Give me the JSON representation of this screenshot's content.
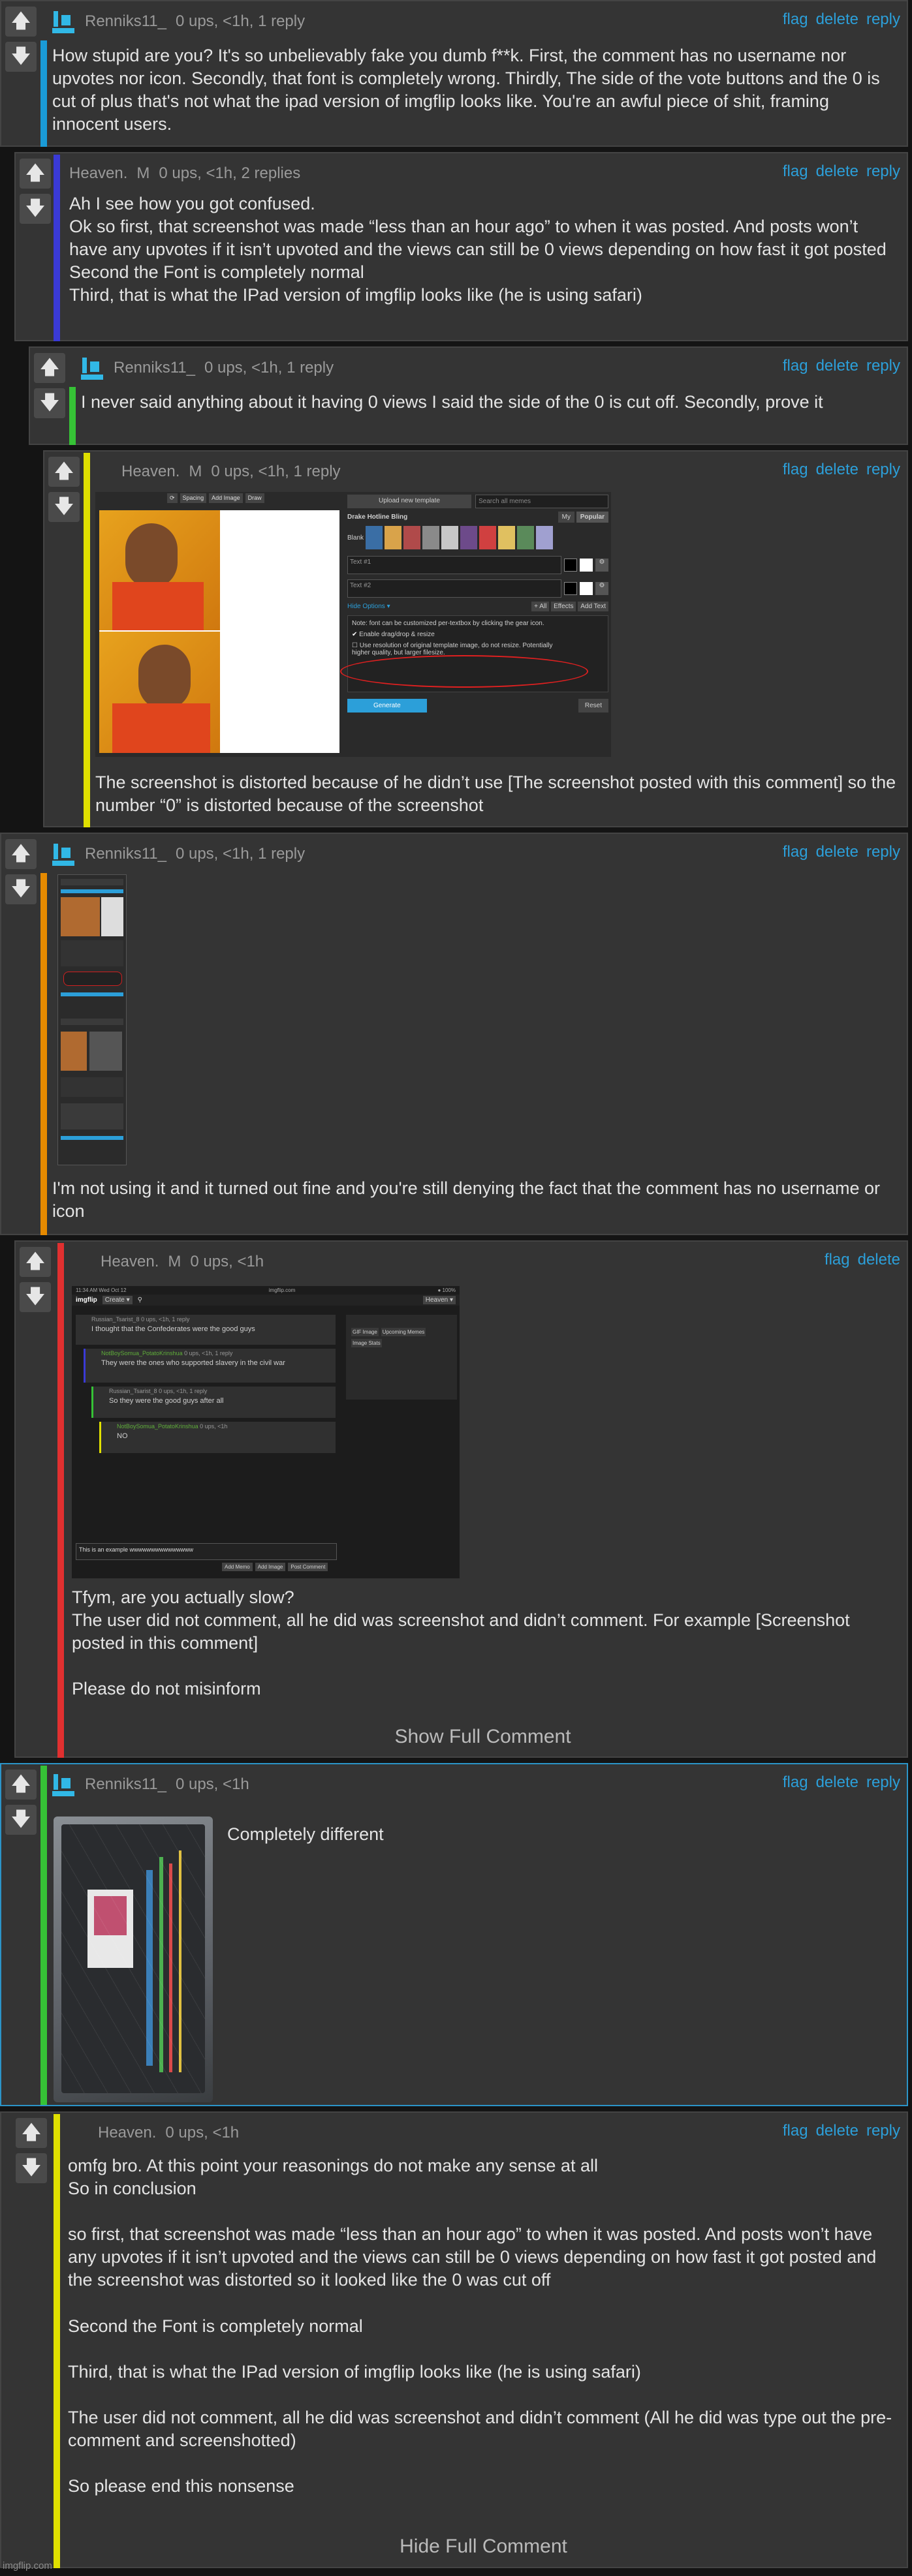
{
  "comments": [
    {
      "user": "Renniks11_",
      "meta": "0 ups, <1h, 1 reply",
      "actions": [
        "flag",
        "delete",
        "reply"
      ],
      "bar_color": "#1a9ad6",
      "text": "How stupid are you? It's so unbelievably fake you dumb f**k. First, the comment has no username nor upvotes nor icon. Secondly, that font is completely wrong. Thirdly, The side of the vote buttons and the 0 is cut of plus that's not what the ipad version of imgflip looks like. You're an awful piece of shit, framing innocent users."
    },
    {
      "user": "Heaven.",
      "user_tag": "M",
      "meta": "0 ups, <1h, 2 replies",
      "actions": [
        "flag",
        "delete",
        "reply"
      ],
      "bar_color": "#3a3ad6",
      "text": "Ah I see how you got confused.\nOk so first, that screenshot was made “less than an hour ago” to when it was posted. And posts won’t have any upvotes if it isn’t upvoted and the views can still be 0 views depending on how fast it got posted\nSecond the Font is completely normal\nThird, that is what the IPad version of imgflip looks like (he is using safari)"
    },
    {
      "user": "Renniks11_",
      "meta": "0 ups, <1h, 1 reply",
      "actions": [
        "flag",
        "delete",
        "reply"
      ],
      "bar_color": "#36c236",
      "text": "I never said anything about it having 0 views I said the side of the 0 is cut off. Secondly, prove it"
    },
    {
      "user": "Heaven.",
      "user_tag": "M",
      "meta": "0 ups, <1h, 1 reply",
      "actions": [
        "flag",
        "delete",
        "reply"
      ],
      "bar_color": "#e0e000",
      "text": "The screenshot is distorted because of he didn’t use [The screenshot posted with this comment] so the number “0” is distorted because of the screenshot",
      "screenshot": {
        "buttons": [
          "Spacing",
          "Add Image",
          "Draw"
        ],
        "upload_label": "Upload new template",
        "search_placeholder": "Search all memes",
        "template_name": "Drake Hotline Bling",
        "tabs": [
          "My",
          "Popular"
        ],
        "blank_label": "Blank",
        "text_fields": [
          "Text #1",
          "Text #2"
        ],
        "hide_options": "Hide Options ▾",
        "option_buttons": [
          "+ All",
          "Effects",
          "Add Text"
        ],
        "note": "Note: font can be customized per-textbox by clicking the gear icon.",
        "checkbox1": "Enable drag/drop & resize",
        "checkbox2": "Use resolution of original template image, do not resize. Potentially higher quality, but larger filesize.",
        "generate": "Generate",
        "reset": "Reset"
      }
    },
    {
      "user": "Renniks11_",
      "meta": "0 ups, <1h, 1 reply",
      "actions": [
        "flag",
        "delete",
        "reply"
      ],
      "bar_color": "#e68a00",
      "text": "I'm not using it and it turned out fine and you're still denying the fact that the comment has no username or icon"
    },
    {
      "user": "Heaven.",
      "user_tag": "M",
      "meta": "0 ups, <1h",
      "actions": [
        "flag",
        "delete"
      ],
      "bar_color": "#e03030",
      "text": "Tfym, are you actually slow?\nThe user did not comment, all he did was screenshot and didn’t comment. For example [Screenshot posted in this comment]\n\nPlease do not misinform",
      "toggle": "Show Full Comment",
      "screenshot": {
        "status_time": "11:34 AM   Wed Oct 12",
        "status_url": "imgflip.com",
        "logo": "imgflip",
        "create": "Create ▾",
        "nav_right": "Heaven ▾",
        "rows": [
          {
            "user": "Russian_Tsarist_8",
            "meta": "0 ups, <1h, 1 reply",
            "text": "I thought that the Confederates were the good guys"
          },
          {
            "user": "NotBoySomua_PotatoKrinshua",
            "meta": "0 ups, <1h, 1 reply",
            "text": "They were the ones who supported slavery in the civil war"
          },
          {
            "user": "Russian_Tsarist_8",
            "meta": "0 ups, <1h, 1 reply",
            "text": "So they were the good guys after all"
          },
          {
            "user": "NotBoySomua_PotatoKrinshua",
            "meta": "0 ups, <1h",
            "text": "NO"
          }
        ],
        "side_items": [
          "GIF Image",
          "Upcoming Memes",
          "Image Stats"
        ],
        "input_text": "This is an example wwwwwwwwwwwwwww",
        "bottom_buttons": [
          "Add Memo",
          "Add Image",
          "Post Comment"
        ]
      }
    },
    {
      "user": "Renniks11_",
      "meta": "0 ups, <1h",
      "actions": [
        "flag",
        "delete",
        "reply"
      ],
      "bar_color": "#36c236",
      "text": "Completely different"
    },
    {
      "user": "Heaven.",
      "meta": "0 ups, <1h",
      "actions": [
        "flag",
        "delete",
        "reply"
      ],
      "bar_color": "#e0e000",
      "text": "omfg bro. At this point your reasonings do not make any sense at all\nSo in conclusion\n\nso first, that screenshot was made “less than an hour ago” to when it was posted. And posts won’t have any upvotes if it isn’t upvoted and the views can still be 0 views depending on how fast it got posted and the screenshot was distorted so it looked like the 0 was cut off\n\nSecond the Font is completely normal\n\nThird, that is what the IPad version of imgflip looks like (he is using safari)\n\nThe user did not comment, all he did was screenshot and didn’t comment (All he did was type out the pre-comment and screenshotted)\n\nSo please end this nonsense",
      "toggle": "Hide Full Comment"
    }
  ],
  "watermark": "imgflip.com"
}
